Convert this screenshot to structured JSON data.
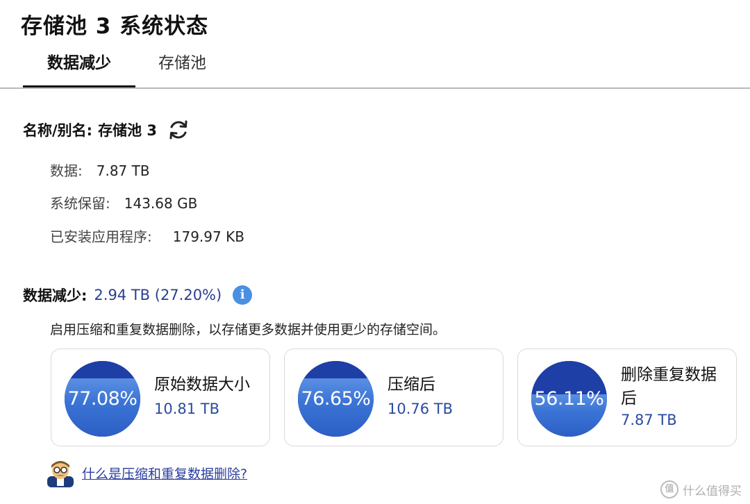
{
  "header": {
    "title": "存储池 3 系统状态"
  },
  "tabs": [
    {
      "label": "数据减少",
      "active": true
    },
    {
      "label": "存储池",
      "active": false
    }
  ],
  "pool": {
    "name_label": "名称/别名:",
    "name_value": "存储池 3",
    "refresh_icon": "refresh-icon",
    "details": [
      {
        "label": "数据:",
        "value": "7.87 TB"
      },
      {
        "label": "系统保留:",
        "value": "143.68 GB"
      },
      {
        "label": "已安装应用程序:",
        "value": "179.97 KB"
      }
    ]
  },
  "reduction": {
    "label": "数据减少:",
    "value": "2.94 TB (27.20%)",
    "info_icon": "info-icon",
    "description": "启用压缩和重复数据删除，以存储更多数据并使用更少的存储空间。"
  },
  "cards": [
    {
      "percent_text": "77.08%",
      "percent": 77.08,
      "label": "原始数据大小",
      "value": "10.81 TB"
    },
    {
      "percent_text": "76.65%",
      "percent": 76.65,
      "label": "压缩后",
      "value": "10.76 TB"
    },
    {
      "percent_text": "56.11%",
      "percent": 56.11,
      "label": "删除重复数据后",
      "value": "7.87 TB"
    }
  ],
  "faq": {
    "link_text": "什么是压缩和重复数据删除?",
    "avatar_icon": "avatar-icon"
  },
  "watermark": {
    "text": "什么值得买",
    "icon_text": "值"
  },
  "colors": {
    "accent": "#2a3f8f",
    "circle_dark": "#1e3fa6",
    "circle_fill": "#3b74d6",
    "info": "#4a90e2"
  }
}
